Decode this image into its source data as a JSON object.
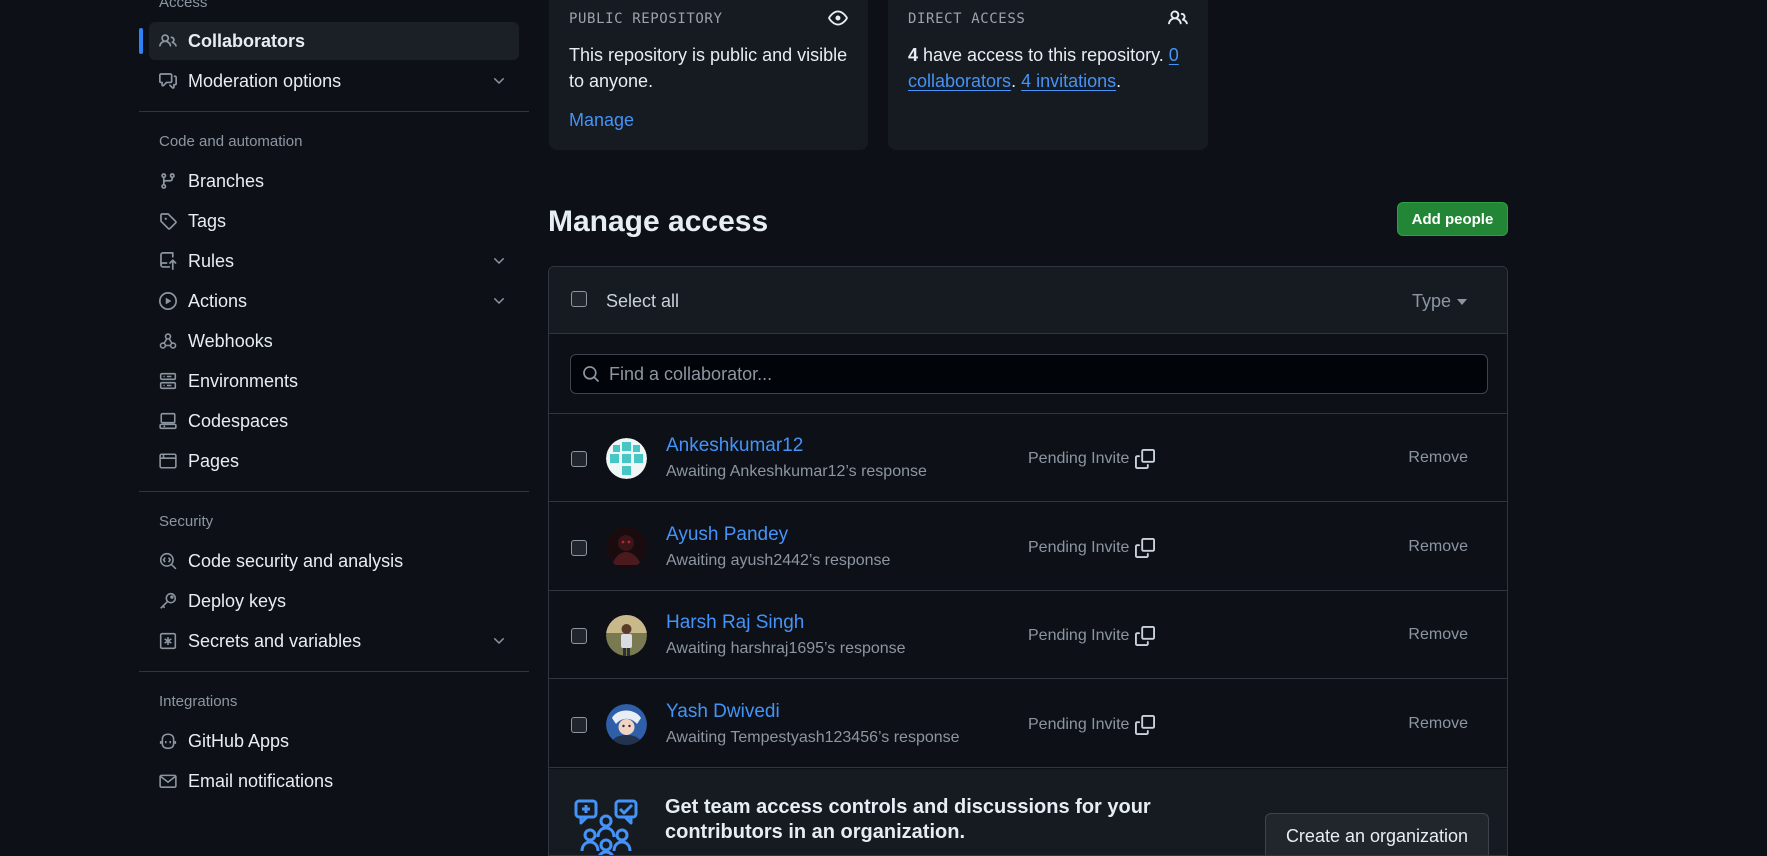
{
  "sidebar": {
    "access_title": "Access",
    "items_access": [
      {
        "label": "Collaborators",
        "icon": "people-icon"
      },
      {
        "label": "Moderation options",
        "icon": "comment-discussion-icon"
      }
    ],
    "code_title": "Code and automation",
    "items_code": [
      {
        "label": "Branches",
        "icon": "git-branch-icon"
      },
      {
        "label": "Tags",
        "icon": "tag-icon"
      },
      {
        "label": "Rules",
        "icon": "repo-push-icon"
      },
      {
        "label": "Actions",
        "icon": "play-icon"
      },
      {
        "label": "Webhooks",
        "icon": "webhook-icon"
      },
      {
        "label": "Environments",
        "icon": "server-icon"
      },
      {
        "label": "Codespaces",
        "icon": "codespaces-icon"
      },
      {
        "label": "Pages",
        "icon": "browser-icon"
      }
    ],
    "security_title": "Security",
    "items_security": [
      {
        "label": "Code security and analysis",
        "icon": "codescan-icon"
      },
      {
        "label": "Deploy keys",
        "icon": "key-icon"
      },
      {
        "label": "Secrets and variables",
        "icon": "key-asterisk-icon"
      }
    ],
    "integrations_title": "Integrations",
    "items_integrations": [
      {
        "label": "GitHub Apps",
        "icon": "copilot-icon"
      },
      {
        "label": "Email notifications",
        "icon": "mail-icon"
      }
    ]
  },
  "public_card": {
    "caption": "PUBLIC REPOSITORY",
    "line1": "This repository is public and visible",
    "line2": "to anyone.",
    "link": "Manage"
  },
  "direct_card": {
    "caption": "DIRECT ACCESS",
    "count": "4",
    "text1": " have access to this repository. ",
    "collab_count": "0",
    "collab_word": "collaborators",
    "sep": ". ",
    "invitations": "4 invitations",
    "end": "."
  },
  "manage": {
    "title": "Manage access",
    "add_button": "Add people",
    "select_all": "Select all",
    "type_filter": "Type",
    "search_placeholder": "Find a collaborator..."
  },
  "collaborators": [
    {
      "name": "Ankeshkumar12",
      "sub": "Awaiting Ankeshkumar12’s response",
      "status": "Pending Invite",
      "action": "Remove"
    },
    {
      "name": "Ayush Pandey",
      "sub": "Awaiting ayush2442’s response",
      "status": "Pending Invite",
      "action": "Remove"
    },
    {
      "name": "Harsh Raj Singh",
      "sub": "Awaiting harshraj1695’s response",
      "status": "Pending Invite",
      "action": "Remove"
    },
    {
      "name": "Yash Dwivedi",
      "sub": "Awaiting Tempestyash123456’s response",
      "status": "Pending Invite",
      "action": "Remove"
    }
  ],
  "promo": {
    "text": "Get team access controls and discussions for your contributors in an organization.",
    "button": "Create an organization"
  },
  "colors": {
    "background": "#0d1117",
    "link": "#4493f8",
    "accent_green": "#238636",
    "active_indicator": "#2f81f7"
  }
}
